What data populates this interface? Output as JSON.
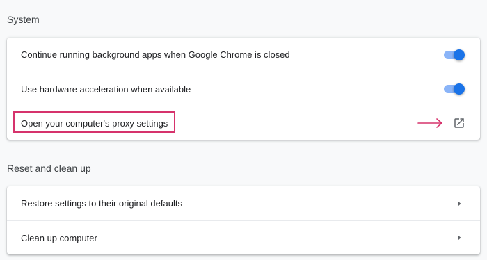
{
  "system": {
    "title": "System",
    "items": [
      {
        "label": "Continue running background apps when Google Chrome is closed",
        "toggle_on": true
      },
      {
        "label": "Use hardware acceleration when available",
        "toggle_on": true
      }
    ],
    "proxy": {
      "label": "Open your computer's proxy settings",
      "icon": "open-in-new-icon"
    }
  },
  "reset": {
    "title": "Reset and clean up",
    "items": [
      {
        "label": "Restore settings to their original defaults",
        "icon": "chevron-right-icon"
      },
      {
        "label": "Clean up computer",
        "icon": "chevron-right-icon"
      }
    ]
  },
  "colors": {
    "accent": "#1a73e8",
    "toggle_track": "#8ab4f8",
    "highlight": "#d6336c"
  }
}
